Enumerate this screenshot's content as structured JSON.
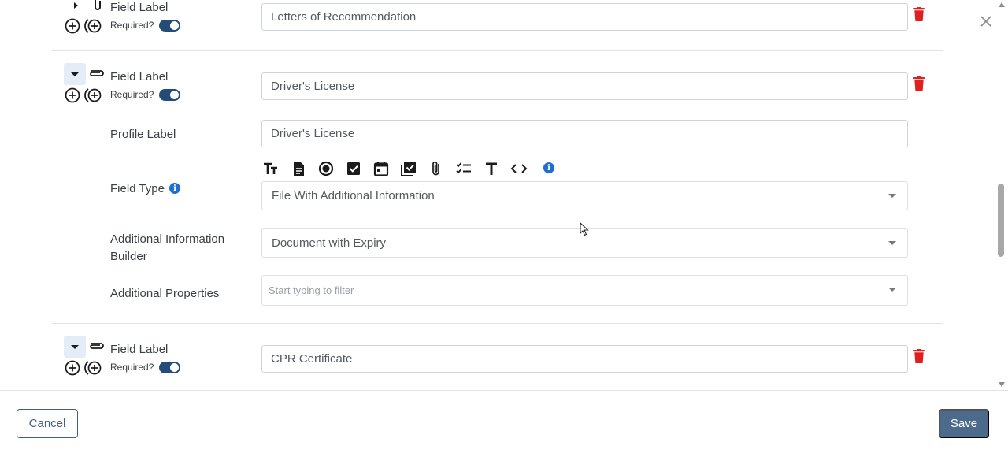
{
  "fields": [
    {
      "field_label": "Field Label",
      "required_label": "Required?",
      "required_on": true,
      "value": "Letters of Recommendation",
      "expanded": false
    },
    {
      "field_label": "Field Label",
      "required_label": "Required?",
      "required_on": true,
      "value": "Driver's License",
      "expanded": true,
      "details": {
        "profile_label_title": "Profile Label",
        "profile_label_value": "Driver's License",
        "field_type_title": "Field Type",
        "field_type_icons": [
          "text-size-icon",
          "document-icon",
          "radio-icon",
          "checkbox-icon",
          "calendar-icon",
          "multi-checkbox-icon",
          "paperclip-icon",
          "checklist-icon",
          "title-icon",
          "code-icon",
          "info-icon"
        ],
        "field_type_value": "File With Additional Information",
        "additional_info_title": "Additional Information Builder",
        "additional_info_value": "Document with Expiry",
        "additional_props_title": "Additional Properties",
        "additional_props_placeholder": "Start typing to filter"
      }
    },
    {
      "field_label": "Field Label",
      "required_label": "Required?",
      "required_on": true,
      "value": "CPR Certificate",
      "expanded": true
    }
  ],
  "footer": {
    "cancel_label": "Cancel",
    "save_label": "Save"
  },
  "colors": {
    "accent": "#234d78",
    "save_bg": "#4c6a8c",
    "trash": "#e0201e",
    "info": "#1f6fd1"
  }
}
